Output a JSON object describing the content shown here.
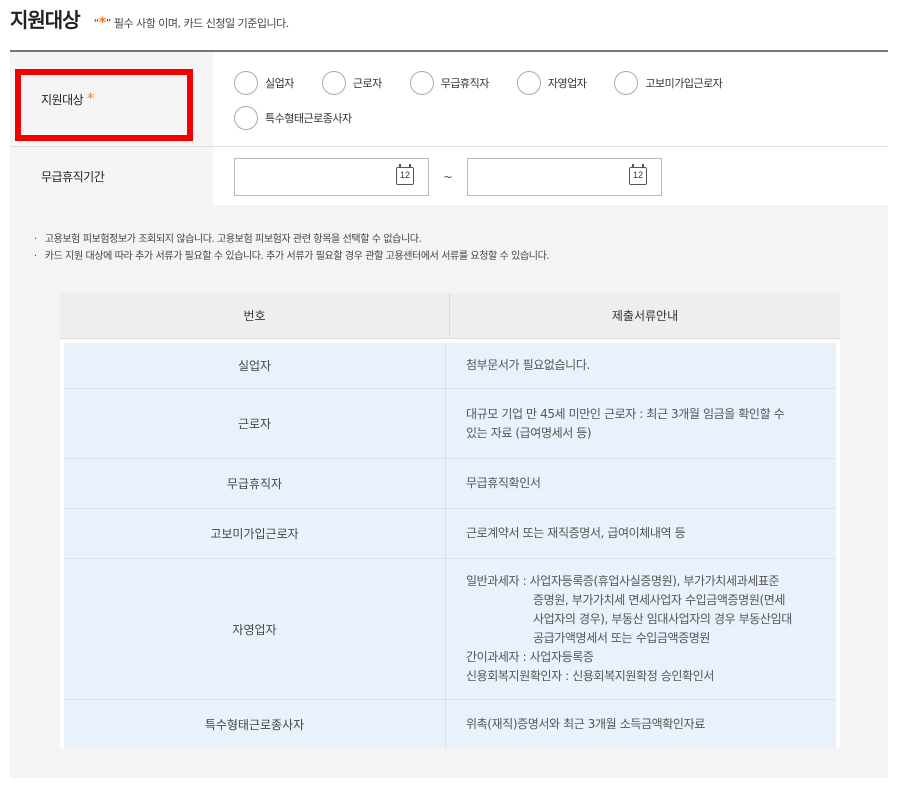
{
  "header": {
    "title": "지원대상",
    "note_open": "“",
    "note_star": "*",
    "note_close": "” 필수 사항 이며, 카드 신청일 기준입니다."
  },
  "form": {
    "target_label": "지원대상",
    "required_mark": "*",
    "options": [
      "실업자",
      "근로자",
      "무급휴직자",
      "자영업자",
      "고보미가입근로자",
      "특수형태근로종사자"
    ],
    "period_label": "무급휴직기간",
    "date_icon_text": "12",
    "tilde": "~"
  },
  "notes": [
    "고용보험 피보험정보가 조회되지 않습니다. 고용보험 피보험자 관련 항목을 선택할 수 없습니다.",
    "카드 지원 대상에 따라 추가 서류가 필요할 수 있습니다. 추가 서류가 필요할 경우 관할 고용센터에서 서류를 요청할 수 있습니다."
  ],
  "docs_table": {
    "headers": [
      "번호",
      "제출서류안내"
    ],
    "rows": [
      {
        "type": "실업자",
        "lines": [
          "첨부문서가 필요없습니다."
        ]
      },
      {
        "type": "근로자",
        "lines": [
          "대규모 기업 만 45세 미만인 근로자 : 최근 3개월 임금을 확인할 수",
          "있는 자료 (급여명세서 등)"
        ]
      },
      {
        "type": "무급휴직자",
        "lines": [
          "무급휴직확인서"
        ]
      },
      {
        "type": "고보미가입근로자",
        "lines": [
          "근로계약서 또는 재직증명서, 급여이체내역 등"
        ]
      },
      {
        "type": "자영업자",
        "lines": [
          "일반과세자 : 사업자등록증(휴업사실증명원), 부가가치세과세표준",
          "증명원, 부가가치세 면세사업자 수입금액증명원(면세",
          "사업자의 경우), 부동산 임대사업자의 경우 부동산임대",
          "공급가액명세서 또는 수입금액증명원",
          "간이과세자 : 사업자등록증",
          "신용회복지원확인자 : 신용회복지원확정 승인확인서"
        ]
      },
      {
        "type": "특수형태근로종사자",
        "lines": [
          "위촉(재직)증명서와 최근 3개월 소득금액확인자료"
        ]
      }
    ]
  }
}
